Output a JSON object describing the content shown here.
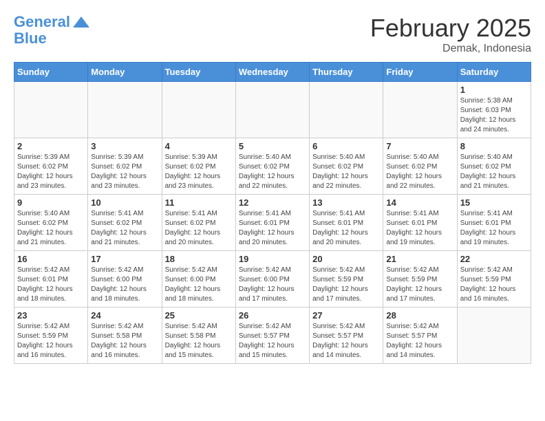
{
  "header": {
    "logo_line1": "General",
    "logo_line2": "Blue",
    "month": "February 2025",
    "location": "Demak, Indonesia"
  },
  "weekdays": [
    "Sunday",
    "Monday",
    "Tuesday",
    "Wednesday",
    "Thursday",
    "Friday",
    "Saturday"
  ],
  "weeks": [
    [
      {
        "day": "",
        "info": ""
      },
      {
        "day": "",
        "info": ""
      },
      {
        "day": "",
        "info": ""
      },
      {
        "day": "",
        "info": ""
      },
      {
        "day": "",
        "info": ""
      },
      {
        "day": "",
        "info": ""
      },
      {
        "day": "1",
        "info": "Sunrise: 5:38 AM\nSunset: 6:03 PM\nDaylight: 12 hours\nand 24 minutes."
      }
    ],
    [
      {
        "day": "2",
        "info": "Sunrise: 5:39 AM\nSunset: 6:02 PM\nDaylight: 12 hours\nand 23 minutes."
      },
      {
        "day": "3",
        "info": "Sunrise: 5:39 AM\nSunset: 6:02 PM\nDaylight: 12 hours\nand 23 minutes."
      },
      {
        "day": "4",
        "info": "Sunrise: 5:39 AM\nSunset: 6:02 PM\nDaylight: 12 hours\nand 23 minutes."
      },
      {
        "day": "5",
        "info": "Sunrise: 5:40 AM\nSunset: 6:02 PM\nDaylight: 12 hours\nand 22 minutes."
      },
      {
        "day": "6",
        "info": "Sunrise: 5:40 AM\nSunset: 6:02 PM\nDaylight: 12 hours\nand 22 minutes."
      },
      {
        "day": "7",
        "info": "Sunrise: 5:40 AM\nSunset: 6:02 PM\nDaylight: 12 hours\nand 22 minutes."
      },
      {
        "day": "8",
        "info": "Sunrise: 5:40 AM\nSunset: 6:02 PM\nDaylight: 12 hours\nand 21 minutes."
      }
    ],
    [
      {
        "day": "9",
        "info": "Sunrise: 5:40 AM\nSunset: 6:02 PM\nDaylight: 12 hours\nand 21 minutes."
      },
      {
        "day": "10",
        "info": "Sunrise: 5:41 AM\nSunset: 6:02 PM\nDaylight: 12 hours\nand 21 minutes."
      },
      {
        "day": "11",
        "info": "Sunrise: 5:41 AM\nSunset: 6:02 PM\nDaylight: 12 hours\nand 20 minutes."
      },
      {
        "day": "12",
        "info": "Sunrise: 5:41 AM\nSunset: 6:01 PM\nDaylight: 12 hours\nand 20 minutes."
      },
      {
        "day": "13",
        "info": "Sunrise: 5:41 AM\nSunset: 6:01 PM\nDaylight: 12 hours\nand 20 minutes."
      },
      {
        "day": "14",
        "info": "Sunrise: 5:41 AM\nSunset: 6:01 PM\nDaylight: 12 hours\nand 19 minutes."
      },
      {
        "day": "15",
        "info": "Sunrise: 5:41 AM\nSunset: 6:01 PM\nDaylight: 12 hours\nand 19 minutes."
      }
    ],
    [
      {
        "day": "16",
        "info": "Sunrise: 5:42 AM\nSunset: 6:01 PM\nDaylight: 12 hours\nand 18 minutes."
      },
      {
        "day": "17",
        "info": "Sunrise: 5:42 AM\nSunset: 6:00 PM\nDaylight: 12 hours\nand 18 minutes."
      },
      {
        "day": "18",
        "info": "Sunrise: 5:42 AM\nSunset: 6:00 PM\nDaylight: 12 hours\nand 18 minutes."
      },
      {
        "day": "19",
        "info": "Sunrise: 5:42 AM\nSunset: 6:00 PM\nDaylight: 12 hours\nand 17 minutes."
      },
      {
        "day": "20",
        "info": "Sunrise: 5:42 AM\nSunset: 5:59 PM\nDaylight: 12 hours\nand 17 minutes."
      },
      {
        "day": "21",
        "info": "Sunrise: 5:42 AM\nSunset: 5:59 PM\nDaylight: 12 hours\nand 17 minutes."
      },
      {
        "day": "22",
        "info": "Sunrise: 5:42 AM\nSunset: 5:59 PM\nDaylight: 12 hours\nand 16 minutes."
      }
    ],
    [
      {
        "day": "23",
        "info": "Sunrise: 5:42 AM\nSunset: 5:59 PM\nDaylight: 12 hours\nand 16 minutes."
      },
      {
        "day": "24",
        "info": "Sunrise: 5:42 AM\nSunset: 5:58 PM\nDaylight: 12 hours\nand 16 minutes."
      },
      {
        "day": "25",
        "info": "Sunrise: 5:42 AM\nSunset: 5:58 PM\nDaylight: 12 hours\nand 15 minutes."
      },
      {
        "day": "26",
        "info": "Sunrise: 5:42 AM\nSunset: 5:57 PM\nDaylight: 12 hours\nand 15 minutes."
      },
      {
        "day": "27",
        "info": "Sunrise: 5:42 AM\nSunset: 5:57 PM\nDaylight: 12 hours\nand 14 minutes."
      },
      {
        "day": "28",
        "info": "Sunrise: 5:42 AM\nSunset: 5:57 PM\nDaylight: 12 hours\nand 14 minutes."
      },
      {
        "day": "",
        "info": ""
      }
    ]
  ]
}
